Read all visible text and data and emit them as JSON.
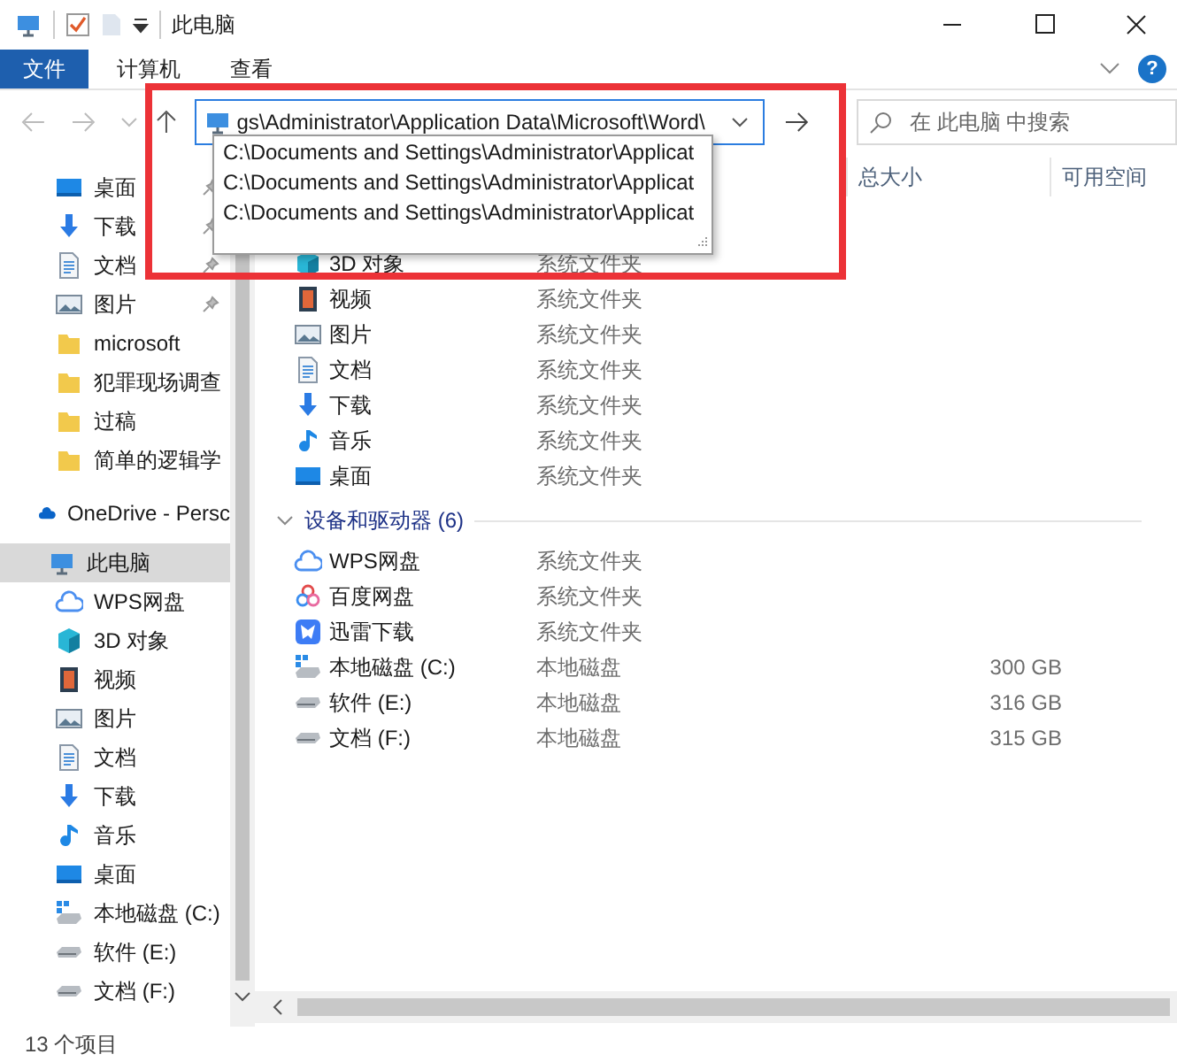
{
  "window": {
    "title": "此电脑"
  },
  "ribbon": {
    "tabs": [
      {
        "label": "文件",
        "kind": "file"
      },
      {
        "label": "计算机",
        "kind": "tab"
      },
      {
        "label": "查看",
        "kind": "tab"
      }
    ],
    "help": "?"
  },
  "address": {
    "value": "gs\\Administrator\\Application Data\\Microsoft\\Word\\",
    "suggestions": [
      "C:\\Documents and Settings\\Administrator\\Applicat",
      "C:\\Documents and Settings\\Administrator\\Applicat",
      "C:\\Documents and Settings\\Administrator\\Applicat"
    ]
  },
  "search": {
    "placeholder": "在 此电脑 中搜索"
  },
  "columns": [
    "总大小",
    "可用空间"
  ],
  "sidebar": {
    "quick_access": [
      {
        "label": "桌面",
        "kind": "desktop",
        "pinned": true
      },
      {
        "label": "下载",
        "kind": "download",
        "pinned": true
      },
      {
        "label": "文档",
        "kind": "docs",
        "pinned": true
      },
      {
        "label": "图片",
        "kind": "pictures",
        "pinned": true
      },
      {
        "label": "microsoft",
        "kind": "folder",
        "pinned": false
      },
      {
        "label": "犯罪现场调查",
        "kind": "folder",
        "pinned": false
      },
      {
        "label": "过稿",
        "kind": "folder",
        "pinned": false
      },
      {
        "label": "简单的逻辑学",
        "kind": "folder",
        "pinned": false
      }
    ],
    "onedrive": {
      "label": "OneDrive - Persc",
      "kind": "cloud",
      "selected": false
    },
    "this_pc": {
      "label": "此电脑",
      "kind": "pc",
      "selected": true,
      "children": [
        {
          "label": "WPS网盘",
          "kind": "wps"
        },
        {
          "label": "3D 对象",
          "kind": "objects"
        },
        {
          "label": "视频",
          "kind": "video"
        },
        {
          "label": "图片",
          "kind": "pictures"
        },
        {
          "label": "文档",
          "kind": "docs"
        },
        {
          "label": "下载",
          "kind": "download"
        },
        {
          "label": "音乐",
          "kind": "music"
        },
        {
          "label": "桌面",
          "kind": "desktop"
        },
        {
          "label": "本地磁盘 (C:)",
          "kind": "drive_c"
        },
        {
          "label": "软件 (E:)",
          "kind": "drive"
        },
        {
          "label": "文档 (F:)",
          "kind": "drive"
        }
      ]
    }
  },
  "folders": [
    {
      "name": "3D 对象",
      "type": "系统文件夹",
      "kind": "objects"
    },
    {
      "name": "视频",
      "type": "系统文件夹",
      "kind": "video"
    },
    {
      "name": "图片",
      "type": "系统文件夹",
      "kind": "pictures"
    },
    {
      "name": "文档",
      "type": "系统文件夹",
      "kind": "docs"
    },
    {
      "name": "下载",
      "type": "系统文件夹",
      "kind": "download"
    },
    {
      "name": "音乐",
      "type": "系统文件夹",
      "kind": "music"
    },
    {
      "name": "桌面",
      "type": "系统文件夹",
      "kind": "desktop"
    }
  ],
  "devices_group": {
    "label": "设备和驱动器 (6)",
    "expanded": true
  },
  "devices": [
    {
      "name": "WPS网盘",
      "type": "系统文件夹",
      "kind": "wps"
    },
    {
      "name": "百度网盘",
      "type": "系统文件夹",
      "kind": "baidu"
    },
    {
      "name": "迅雷下载",
      "type": "系统文件夹",
      "kind": "xunlei"
    },
    {
      "name": "本地磁盘 (C:)",
      "type": "本地磁盘",
      "kind": "drive_c",
      "total": "300 GB"
    },
    {
      "name": "软件 (E:)",
      "type": "本地磁盘",
      "kind": "drive",
      "total": "316 GB"
    },
    {
      "name": "文档 (F:)",
      "type": "本地磁盘",
      "kind": "drive",
      "total": "315 GB"
    }
  ],
  "status_bar": {
    "count": "13 个项目"
  }
}
